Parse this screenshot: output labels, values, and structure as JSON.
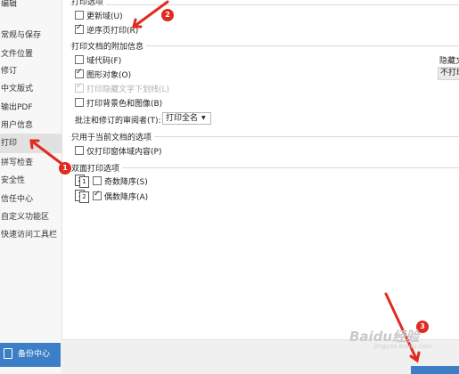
{
  "sidebar": {
    "items": [
      {
        "label": "编辑"
      },
      {
        "label": "常规与保存"
      },
      {
        "label": "文件位置"
      },
      {
        "label": "修订"
      },
      {
        "label": "中文版式"
      },
      {
        "label": "输出PDF"
      },
      {
        "label": "用户信息"
      },
      {
        "label": "打印"
      },
      {
        "label": "拼写检查"
      },
      {
        "label": "安全性"
      },
      {
        "label": "信任中心"
      },
      {
        "label": "自定义功能区"
      },
      {
        "label": "快速访问工具栏"
      }
    ],
    "backup_label": "备份中心"
  },
  "print_options": {
    "section_title": "打印选项",
    "update_fields": "更新域(U)",
    "reverse_order": "逆序页打印(R)"
  },
  "additional_info": {
    "section_title": "打印文档的附加信息",
    "field_codes": "域代码(F)",
    "drawing_objects": "图形对象(O)",
    "hidden_underline": "打印隐藏文字下划线(L)",
    "background": "打印背景色和图像(B)",
    "markup_label": "批注和修订的审阅者(T):",
    "markup_value": "打印全名",
    "hidden_text_label": "隐藏文",
    "hidden_text_value": "不打印"
  },
  "current_doc": {
    "section_title": "只用于当前文档的选项",
    "form_data_only": "仅打印窗体域内容(P)"
  },
  "duplex": {
    "section_title": "双面打印选项",
    "odd_reverse": "奇数降序(S)",
    "even_reverse": "偶数降序(A)",
    "page_numbers": [
      "1",
      "2"
    ]
  },
  "annotations": {
    "markers": [
      "1",
      "2",
      "3"
    ],
    "color": "#e02b20"
  },
  "watermark": {
    "text": "Baidu经验",
    "sub": "jingyan.baidu.com"
  },
  "colors": {
    "accent": "#3c7fc6",
    "selected_bg": "#e1e1e1"
  }
}
